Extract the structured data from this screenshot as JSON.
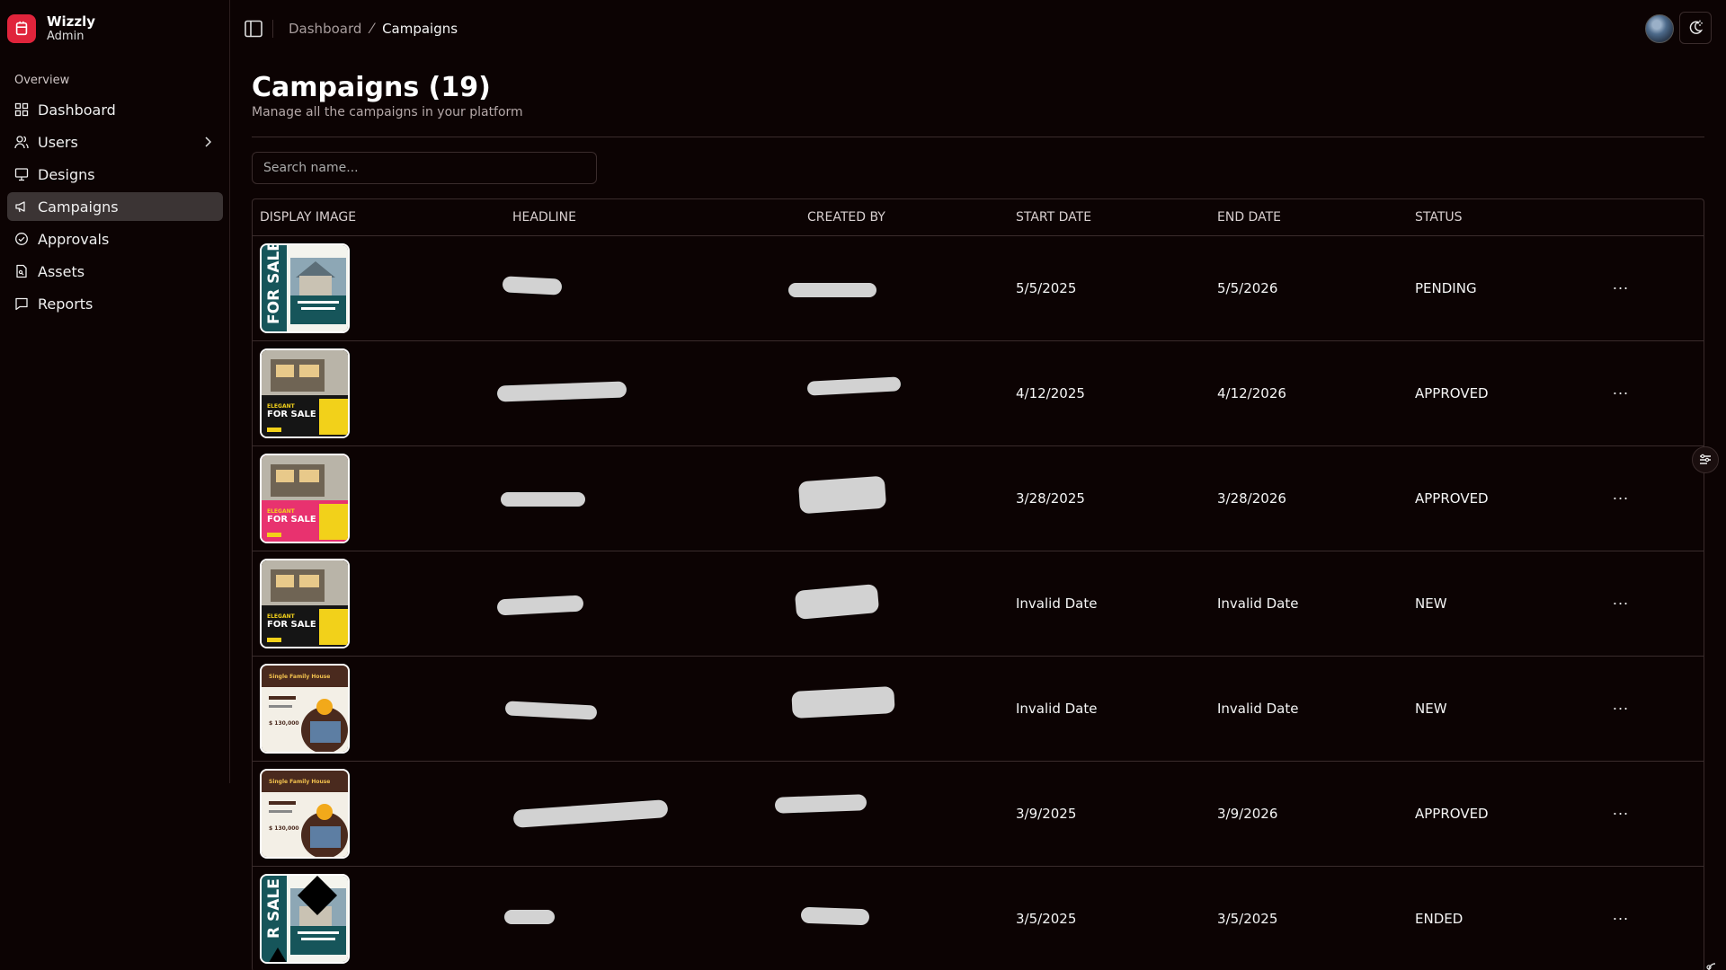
{
  "brand": {
    "name": "Wizzly",
    "role": "Admin",
    "color": "#e0243b"
  },
  "sidebar": {
    "group_label": "Overview",
    "items": [
      {
        "label": "Dashboard",
        "icon": "grid-icon"
      },
      {
        "label": "Users",
        "icon": "users-icon",
        "has_submenu": true
      },
      {
        "label": "Designs",
        "icon": "presentation-icon"
      },
      {
        "label": "Campaigns",
        "icon": "megaphone-icon",
        "active": true
      },
      {
        "label": "Approvals",
        "icon": "badge-check-icon"
      },
      {
        "label": "Assets",
        "icon": "file-icon"
      },
      {
        "label": "Reports",
        "icon": "message-icon"
      }
    ]
  },
  "header": {
    "breadcrumb": [
      "Dashboard",
      "Campaigns"
    ]
  },
  "page": {
    "title": "Campaigns (19)",
    "subtitle": "Manage all the campaigns in your platform",
    "search_placeholder": "Search name..."
  },
  "table": {
    "columns": [
      "DISPLAY IMAGE",
      "HEADLINE",
      "CREATED BY",
      "START DATE",
      "END DATE",
      "STATUS"
    ],
    "rows": [
      {
        "thumb": "sale-teal",
        "headline_redacted": true,
        "created_by_redacted": true,
        "start": "5/5/2025",
        "end": "5/5/2026",
        "status": "PENDING"
      },
      {
        "thumb": "elegant-black",
        "headline_redacted": true,
        "created_by_redacted": true,
        "start": "4/12/2025",
        "end": "4/12/2026",
        "status": "APPROVED"
      },
      {
        "thumb": "elegant-pink",
        "headline_redacted": true,
        "created_by_redacted": true,
        "start": "3/28/2025",
        "end": "3/28/2026",
        "status": "APPROVED"
      },
      {
        "thumb": "elegant-black",
        "headline_redacted": true,
        "created_by_redacted": true,
        "start": "Invalid Date",
        "end": "Invalid Date",
        "status": "NEW"
      },
      {
        "thumb": "family-brown",
        "headline_redacted": true,
        "created_by_redacted": true,
        "start": "Invalid Date",
        "end": "Invalid Date",
        "status": "NEW"
      },
      {
        "thumb": "family-brown",
        "headline_redacted": true,
        "created_by_redacted": true,
        "start": "3/9/2025",
        "end": "3/9/2026",
        "status": "APPROVED"
      },
      {
        "thumb": "sale-teal",
        "headline_redacted": true,
        "created_by_redacted": true,
        "start": "3/5/2025",
        "end": "3/5/2025",
        "status": "ENDED"
      }
    ],
    "row_action_label": "···"
  }
}
